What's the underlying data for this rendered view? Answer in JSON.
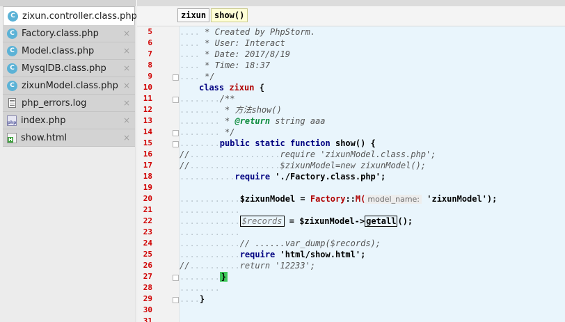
{
  "file_tabs": [
    {
      "name": "zixun.controller.class.php",
      "icon": "php-class-icon",
      "active": true
    },
    {
      "name": "Factory.class.php",
      "icon": "php-class-icon",
      "active": false
    },
    {
      "name": "Model.class.php",
      "icon": "php-class-icon",
      "active": false
    },
    {
      "name": "MysqlDB.class.php",
      "icon": "php-class-icon",
      "active": false
    },
    {
      "name": "zixunModel.class.php",
      "icon": "php-class-icon",
      "active": false
    },
    {
      "name": "php_errors.log",
      "icon": "log-file-icon",
      "active": false
    },
    {
      "name": "index.php",
      "icon": "php-file-icon",
      "active": false
    },
    {
      "name": "show.html",
      "icon": "html-file-icon",
      "active": false
    }
  ],
  "icon_text": {
    "c": "C",
    "php": "php",
    "html": "H"
  },
  "close_glyph": "×",
  "breadcrumb": [
    "zixun",
    "show()"
  ],
  "code": {
    "l5": {
      "num": "5",
      "dots": "....",
      "text": " * Created by PhpStorm."
    },
    "l6": {
      "num": "6",
      "dots": "....",
      "text": " * User: Interact"
    },
    "l7": {
      "num": "7",
      "dots": "....",
      "text": " * Date: 2017/8/19"
    },
    "l8": {
      "num": "8",
      "dots": "....",
      "text": " * Time: 18:37"
    },
    "l9": {
      "num": "9",
      "dots": "....",
      "text": " */"
    },
    "l10": {
      "num": "10",
      "kw": "class",
      "cls": "zixun",
      "rest": " {"
    },
    "l11": {
      "num": "11",
      "dots": "........",
      "text": "/**"
    },
    "l12": {
      "num": "12",
      "dots": "........",
      "text": " * 方法show()"
    },
    "l13": {
      "num": "13",
      "dots": "........",
      "pre": " * ",
      "tag": "@return",
      "text": " string aaa"
    },
    "l14": {
      "num": "14",
      "dots": "........",
      "text": " */"
    },
    "l15": {
      "num": "15",
      "dots": "........",
      "kw": "public static function",
      "fn": "show",
      "rest": "() {"
    },
    "l16": {
      "num": "16",
      "pre": "//",
      "dots": "..................",
      "text": "require 'zixunModel.class.php';"
    },
    "l17": {
      "num": "17",
      "pre": "//",
      "dots": "..................",
      "text": "$zixunModel=new zixunModel();"
    },
    "l18": {
      "num": "18",
      "dots": "...........",
      "kw": "require",
      "str": " './Factory.class.php';"
    },
    "l19": {
      "num": "19",
      "dots": ""
    },
    "l20": {
      "num": "20",
      "dots": "............",
      "var": "$zixunModel",
      "op": " = ",
      "cls": "Factory",
      "sep": "::",
      "m": "M(",
      "hint": "model_name:",
      "arg": " 'zixunModel');"
    },
    "l21": {
      "num": "21",
      "dots": "............"
    },
    "l22": {
      "num": "22",
      "dots": "............",
      "boxvar": "$records",
      "op": " = ",
      "var": "$zixunModel->",
      "boxfn": "getall",
      "rest": "();"
    },
    "l23": {
      "num": "23",
      "dots": "............"
    },
    "l24": {
      "num": "24",
      "dots": "............",
      "text": "// ......var_dump($records);"
    },
    "l25": {
      "num": "25",
      "dots": "............",
      "kw": "require",
      "str": " 'html/show.html';"
    },
    "l26": {
      "num": "26",
      "pre": "//",
      "dots": "..........",
      "text": "return '12233';"
    },
    "l27": {
      "num": "27",
      "dots": "........",
      "brace": "}"
    },
    "l28": {
      "num": "28",
      "dots": "........"
    },
    "l29": {
      "num": "29",
      "dots": "....",
      "text": "}"
    },
    "l30": {
      "num": "30"
    },
    "l31": {
      "num": "31"
    }
  },
  "colors": {
    "current_line": "#00ffff",
    "line_numbers": "#d00000",
    "editor_bg": "#e9f5fc"
  }
}
